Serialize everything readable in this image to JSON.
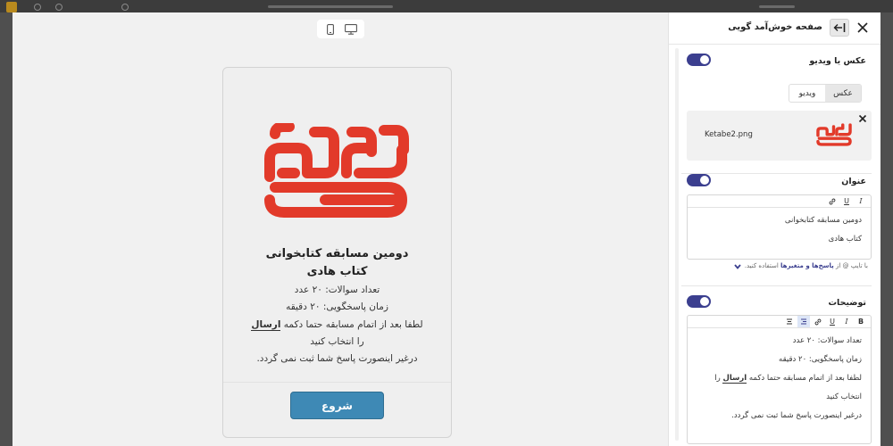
{
  "preview": {
    "card": {
      "title_line1": "دومین مسابقه کتابخوانی",
      "title_line2": "کتاب هادی",
      "body": {
        "line1": "تعداد سوالات: ۲۰ عدد",
        "line2": "زمان پاسخگویی: ۲۰ دقیقه",
        "line3_pre": "لطفا بعد از اتمام مسابقه حتما دکمه ",
        "line3_bold": "ارسال",
        "line4": "را انتخاب کنید",
        "line5": "درغیر اینصورت پاسخ شما ثبت نمی گردد."
      },
      "start_label": "شروع",
      "logo_color": "#e23a2a"
    },
    "device_icons": [
      "mobile-icon",
      "desktop-icon"
    ]
  },
  "settings": {
    "title": "صفحه خوش‌آمد گویی",
    "media": {
      "label": "عکس یا ویدیو",
      "tab_image": "عکس",
      "tab_video": "ویدیو",
      "filename": "Ketabe2.png"
    },
    "heading": {
      "label": "عنوان",
      "line1": "دومین مسابقه کتابخوانی",
      "line2": "کتاب هادی",
      "hint_pre": "با تایپ @ از ",
      "hint_link": "پاسخ‌ها و متغیرها",
      "hint_post": " استفاده کنید."
    },
    "description": {
      "label": "توضیحات",
      "line1": "تعداد سوالات: ۲۰ عدد",
      "line2": "زمان پاسخگویی: ۲۰ دقیقه",
      "line3_pre": "لطفا بعد از اتمام مسابقه حتما دکمه ",
      "line3_bold": "ارسال",
      "line3_post": " را",
      "line4": "انتخاب کنید",
      "line5": "درغیر اینصورت پاسخ شما ثبت نمی گردد."
    },
    "toolbar_heading": [
      "I",
      "U",
      "link-icon"
    ],
    "toolbar_description": [
      "B",
      "I",
      "U",
      "link-icon",
      "align-right-icon",
      "align-center-icon"
    ],
    "accent": "#3b3f8f"
  }
}
